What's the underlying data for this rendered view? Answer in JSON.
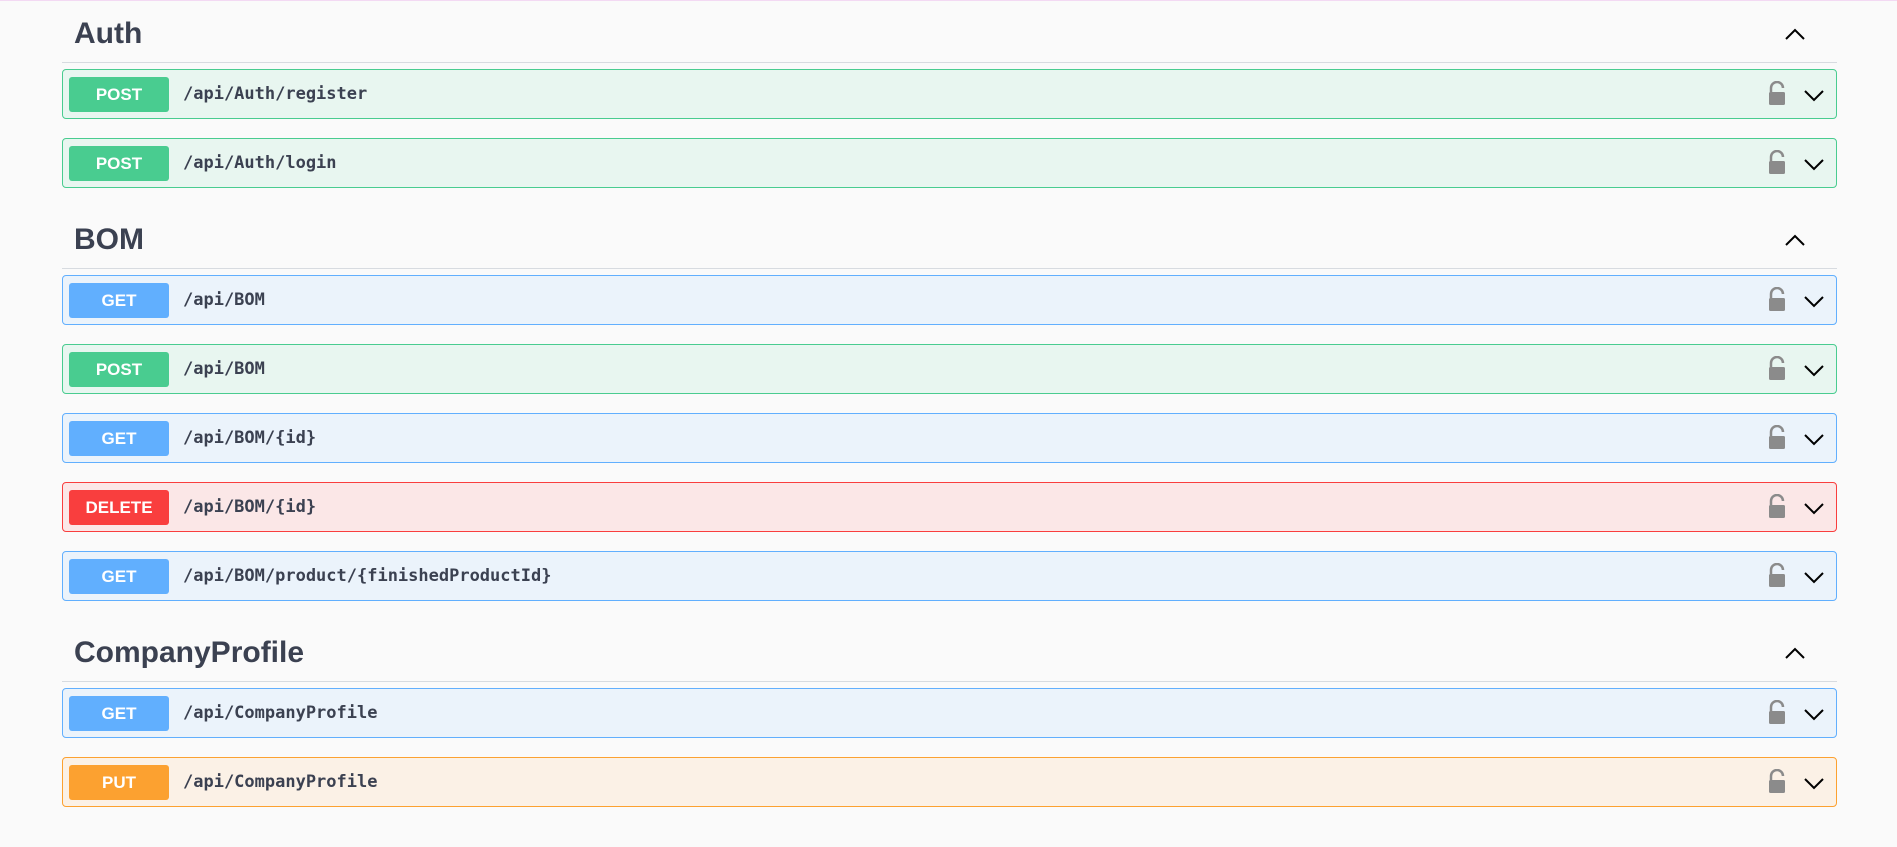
{
  "sections": [
    {
      "title": "Auth",
      "ops": [
        {
          "method": "POST",
          "path": "/api/Auth/register"
        },
        {
          "method": "POST",
          "path": "/api/Auth/login"
        }
      ]
    },
    {
      "title": "BOM",
      "ops": [
        {
          "method": "GET",
          "path": "/api/BOM"
        },
        {
          "method": "POST",
          "path": "/api/BOM"
        },
        {
          "method": "GET",
          "path": "/api/BOM/{id}"
        },
        {
          "method": "DELETE",
          "path": "/api/BOM/{id}"
        },
        {
          "method": "GET",
          "path": "/api/BOM/product/{finishedProductId}"
        }
      ]
    },
    {
      "title": "CompanyProfile",
      "ops": [
        {
          "method": "GET",
          "path": "/api/CompanyProfile"
        },
        {
          "method": "PUT",
          "path": "/api/CompanyProfile"
        }
      ]
    }
  ],
  "colors": {
    "get": "#61affe",
    "post": "#49cc90",
    "delete": "#f93e3e",
    "put": "#fca130",
    "text": "#3b4151"
  },
  "icons": {
    "section_toggle": "chevron-up-icon",
    "lock": "lock-icon",
    "expand": "chevron-down-icon"
  }
}
